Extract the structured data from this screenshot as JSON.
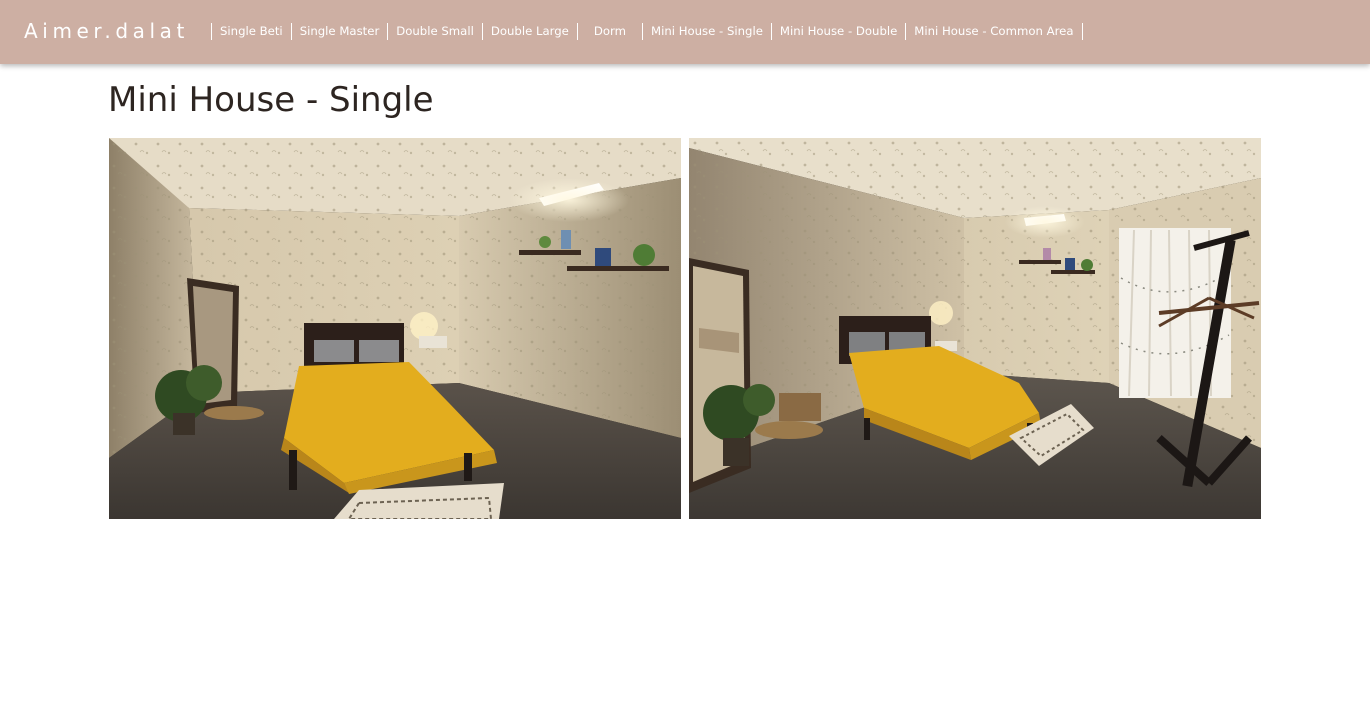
{
  "header": {
    "brand": "Aimer.dalat",
    "nav": [
      {
        "label": "Single Beti"
      },
      {
        "label": "Single Master"
      },
      {
        "label": "Double Small"
      },
      {
        "label": "Double Large"
      },
      {
        "label": "Dorm"
      },
      {
        "label": "Mini House - Single"
      },
      {
        "label": "Mini House - Double"
      },
      {
        "label": "Mini House - Common Area"
      }
    ]
  },
  "main": {
    "title": "Mini House - Single"
  },
  "colors": {
    "header_bg": "#cdafa3",
    "title_text": "#2d2521",
    "bedspread": "#e3ad1e"
  }
}
